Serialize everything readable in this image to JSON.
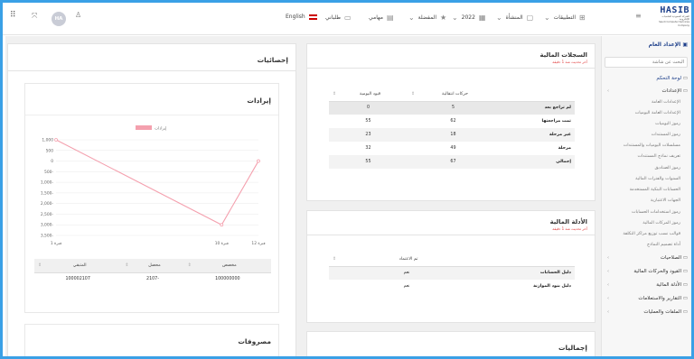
{
  "header": {
    "lang": "English",
    "user_name": "طلباني",
    "user_initials": "HA",
    "menu_items": [
      "مهامي",
      "المفضلة",
      "2022",
      "المنشأة",
      "التطبيقات"
    ],
    "logo_text": "HASIB",
    "logo_sub_ar": "الشركة السعودية للحاسبات الإلكترونية",
    "logo_sub_en": "Saudi Computer Services Company"
  },
  "sidebar": {
    "title": "الإعداد العام",
    "search_placeholder": "البحث عن شاشة",
    "items": [
      {
        "label": "لوحة التحكم",
        "kind": "main"
      },
      {
        "label": "الإعدادات",
        "kind": "main"
      },
      {
        "label": "الإعدادات العامة",
        "kind": "sub"
      },
      {
        "label": "الإعدادات العامة اليوميات",
        "kind": "sub"
      },
      {
        "label": "رموز اليوميات",
        "kind": "sub"
      },
      {
        "label": "رموز المستندات",
        "kind": "sub"
      },
      {
        "label": "مسلسلات اليوميات والمستندات",
        "kind": "sub"
      },
      {
        "label": "تعريف نماذج المستندات",
        "kind": "sub"
      },
      {
        "label": "رموز الصناديق",
        "kind": "sub"
      },
      {
        "label": "السنوات والفترات المالية",
        "kind": "sub"
      },
      {
        "label": "الحسابات البنكية المستخدمة",
        "kind": "sub"
      },
      {
        "label": "الجهات الاعتبارية",
        "kind": "sub"
      },
      {
        "label": "رموز استخدامات الحسابات",
        "kind": "sub"
      },
      {
        "label": "رموز المركات المالية",
        "kind": "sub"
      },
      {
        "label": "قوالب نسب توزيع مراكز التكلفة",
        "kind": "sub"
      },
      {
        "label": "أداة تصميم النماذج",
        "kind": "sub"
      },
      {
        "label": "الصلاحيات",
        "kind": "main"
      },
      {
        "label": "القيود والحركات المالية",
        "kind": "main"
      },
      {
        "label": "الأدلة المالية",
        "kind": "main"
      },
      {
        "label": "التقارير والاستعلامات",
        "kind": "main"
      },
      {
        "label": "الملفات والعمليات",
        "kind": "main"
      }
    ]
  },
  "stats_panel": {
    "title": "إحصائيات"
  },
  "revenue_panel": {
    "title": "إيرادات",
    "legend": "إيرادات",
    "table_headers": [
      "مخصص",
      "محصل",
      "المتبقي"
    ],
    "table_row": [
      "100000000",
      "2107-",
      "100002107"
    ]
  },
  "chart_data": {
    "type": "line",
    "x": [
      "فترة 1",
      "فترة 10",
      "فترة 12"
    ],
    "x_values": [
      1,
      10,
      12
    ],
    "series": [
      {
        "name": "إيرادات",
        "values": [
          1000,
          -3000,
          0
        ]
      }
    ],
    "ylim": [
      -3500,
      1000
    ],
    "yticks": [
      "1,000",
      "500",
      "0",
      "500-",
      "1,000-",
      "1,500-",
      "2,000-",
      "2,500-",
      "3,000-",
      "3,500-"
    ],
    "color": "#f4a0ae"
  },
  "expenses_panel": {
    "title": "مصروفات"
  },
  "records_panel": {
    "title": "السجلات المالية",
    "subtitle": "آخر تحديث منذ 1 دقيقة",
    "headers": [
      "حركات انتقالية",
      "قيود اليومية"
    ],
    "rows": [
      {
        "label": "لم تراجع بعد",
        "a": "5",
        "b": "0"
      },
      {
        "label": "تمت مراجعتها",
        "a": "62",
        "b": "55"
      },
      {
        "label": "غير مرحلة",
        "a": "18",
        "b": "23"
      },
      {
        "label": "مرحلة",
        "a": "49",
        "b": "32"
      },
      {
        "label": "إجمالي",
        "a": "67",
        "b": "55"
      }
    ]
  },
  "guides_panel": {
    "title": "الأدلة المالية",
    "subtitle": "آخر تحديث منذ 1 دقيقة",
    "header": "تم الاعتماد",
    "rows": [
      {
        "label": "دليل الحسابات",
        "value": "نعم"
      },
      {
        "label": "دليل بنود الموازنة",
        "value": "نعم"
      }
    ]
  },
  "totals_panel": {
    "title": "إجماليات"
  },
  "colors": {
    "accent": "#1d3f8a",
    "frame": "#3aa0e6",
    "alert": "#e03a3a",
    "line": "#f4a0ae"
  }
}
